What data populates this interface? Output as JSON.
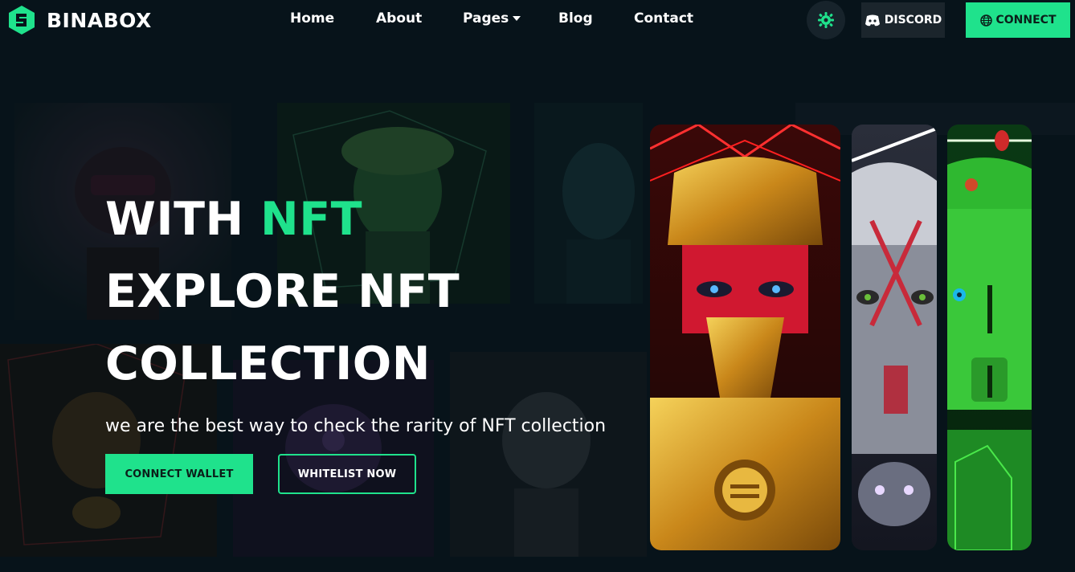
{
  "brand": {
    "name": "BINABOX"
  },
  "nav": {
    "items": [
      {
        "label": "Home"
      },
      {
        "label": "About"
      },
      {
        "label": "Pages",
        "has_dropdown": true
      },
      {
        "label": "Blog"
      },
      {
        "label": "Contact"
      }
    ],
    "theme_toggle_icon": "gear-icon",
    "discord_label": "DISCORD",
    "discord_icon": "discord-icon",
    "connect_label": "CONNECT",
    "connect_icon": "globe-icon"
  },
  "hero": {
    "headline_line1_prefix": "WITH ",
    "headline_line1_accent": "NFT",
    "headline_line2": "EXPLORE NFT",
    "headline_line3": "COLLECTION",
    "subtitle": "we are the best way to check the rarity of NFT collection",
    "primary_button": "CONNECT WALLET",
    "secondary_button": "WHITELIST NOW"
  },
  "colors": {
    "accent": "#1fe28c",
    "background": "#07131a",
    "discord_bg": "#1b252c"
  }
}
